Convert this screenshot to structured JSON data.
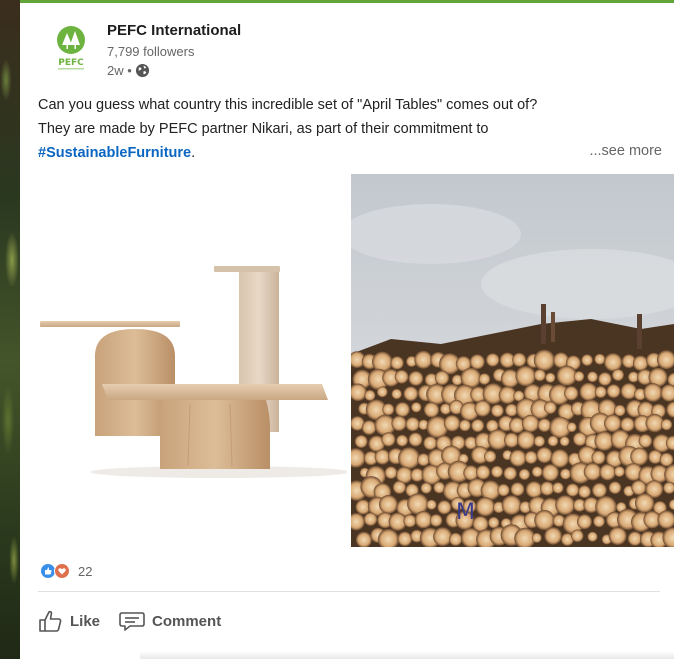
{
  "post": {
    "company_name": "PEFC International",
    "followers": "7,799 followers",
    "age": "2w •",
    "logo_text": "PEFC",
    "text_line1": "Can you guess what country this incredible set of \"April Tables\" comes out of?",
    "text_line2": "They are made by PEFC partner Nikari, as part of their commitment to",
    "hashtag": "#SustainableFurniture",
    "hashtag_suffix": ".",
    "see_more": "...see more",
    "log_mark": "M"
  },
  "reactions": {
    "count": "22",
    "icons": [
      "like-icon",
      "heart-icon"
    ]
  },
  "actions": {
    "like_label": "Like",
    "comment_label": "Comment"
  },
  "colors": {
    "accent_green": "#61a53b",
    "link_blue": "#0a66c2",
    "like_blue": "#378fe9",
    "heart_red": "#df704d"
  }
}
